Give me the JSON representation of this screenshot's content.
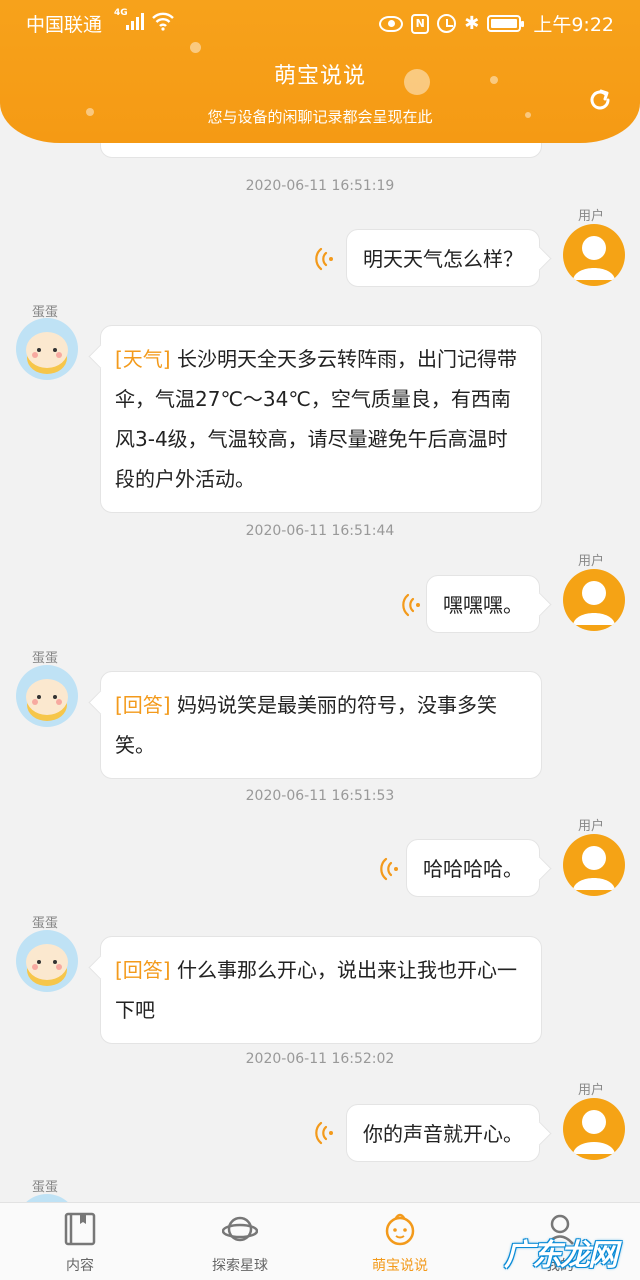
{
  "status_bar": {
    "carrier": "中国联通",
    "network_type": "4G",
    "time": "上午9:22"
  },
  "header": {
    "title": "萌宝说说",
    "subtitle": "您与设备的闲聊记录都会呈现在此",
    "refresh_icon": "refresh-icon",
    "color": "#f59a14"
  },
  "chat": {
    "user_name": "用户",
    "bot_name": "蛋蛋",
    "accent_color": "#f39a1b",
    "timestamps": [
      "2020-06-11 16:51:19",
      "2020-06-11 16:51:44",
      "2020-06-11 16:51:53",
      "2020-06-11 16:52:02"
    ],
    "user_messages": [
      "明天天气怎么样？",
      "嘿嘿嘿。",
      "哈哈哈哈。",
      "你的声音就开心。"
    ],
    "bot_replies": [
      {
        "tag": "[天气]",
        "text": " 长沙明天全天多云转阵雨，出门记得带伞，气温27℃～34℃，空气质量良，有西南风3-4级，气温较高，请尽量避免午后高温时段的户外活动。"
      },
      {
        "tag": "[回答]",
        "text": " 妈妈说笑是最美丽的符号，没事多笑笑。"
      },
      {
        "tag": "[回答]",
        "text": " 什么事那么开心，说出来让我也开心一下吧"
      }
    ]
  },
  "tabbar": {
    "tabs": [
      {
        "label": "内容",
        "icon": "book-icon",
        "active": false
      },
      {
        "label": "探索星球",
        "icon": "planet-icon",
        "active": false
      },
      {
        "label": "萌宝说说",
        "icon": "baby-face-icon",
        "active": true
      },
      {
        "label": "我的",
        "icon": "profile-icon",
        "active": false
      }
    ]
  },
  "watermark": "广东龙网"
}
